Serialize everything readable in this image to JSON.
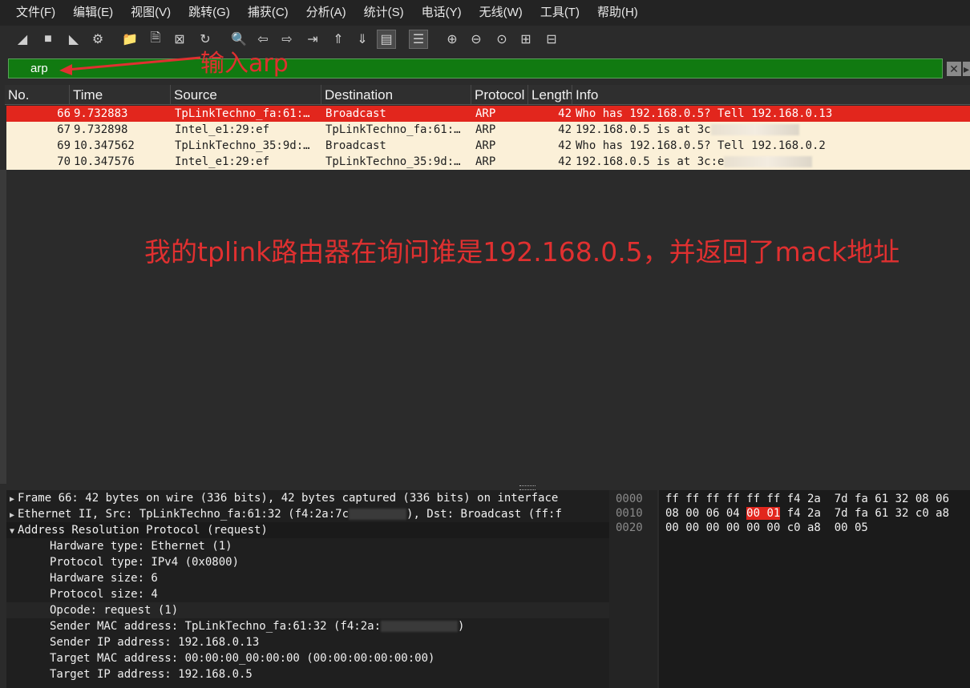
{
  "menu": [
    "文件(F)",
    "编辑(E)",
    "视图(V)",
    "跳转(G)",
    "捕获(C)",
    "分析(A)",
    "统计(S)",
    "电话(Y)",
    "无线(W)",
    "工具(T)",
    "帮助(H)"
  ],
  "toolbar_icons": [
    "shark-fin-start-icon",
    "stop-icon",
    "restart-icon",
    "options-gear-icon",
    "open-folder-icon",
    "file-icon",
    "close-file-icon",
    "reload-icon",
    "find-icon",
    "back-arrow-icon",
    "forward-arrow-icon",
    "goto-packet-icon",
    "first-packet-icon",
    "last-packet-icon",
    "autoscroll-icon",
    "colorize-icon",
    "zoom-in-icon",
    "zoom-out-icon",
    "zoom-normal-icon",
    "resize-columns-icon",
    "layout-icon"
  ],
  "filter": {
    "value": "arp"
  },
  "annotations": {
    "filter_hint": "输入arp",
    "main_note": "我的tplink路由器在询问谁是192.168.0.5，并返回了mack地址"
  },
  "columns": [
    "No.",
    "Time",
    "Source",
    "Destination",
    "Protocol",
    "Length",
    "Info"
  ],
  "packets": [
    {
      "no": "66",
      "time": "9.732883",
      "source": "TpLinkTechno_fa:61:…",
      "destination": "Broadcast",
      "protocol": "ARP",
      "length": "42",
      "info": "Who has 192.168.0.5? Tell 192.168.0.13"
    },
    {
      "no": "67",
      "time": "9.732898",
      "source": "Intel_e1:29:ef",
      "destination": "TpLinkTechno_fa:61:…",
      "protocol": "ARP",
      "length": "42",
      "info": "192.168.0.5 is at 3c"
    },
    {
      "no": "69",
      "time": "10.347562",
      "source": "TpLinkTechno_35:9d:…",
      "destination": "Broadcast",
      "protocol": "ARP",
      "length": "42",
      "info": "Who has 192.168.0.5? Tell 192.168.0.2"
    },
    {
      "no": "70",
      "time": "10.347576",
      "source": "Intel_e1:29:ef",
      "destination": "TpLinkTechno_35:9d:…",
      "protocol": "ARP",
      "length": "42",
      "info": "192.168.0.5 is at 3c:e"
    }
  ],
  "details": {
    "frame": "Frame 66: 42 bytes on wire (336 bits), 42 bytes captured (336 bits) on interface",
    "ethernet_a": "Ethernet II, Src: TpLinkTechno_fa:61:32 (f4:2a:7c",
    "ethernet_b": "), Dst: Broadcast (ff:f",
    "arp": "Address Resolution Protocol (request)",
    "fields": [
      "Hardware type: Ethernet (1)",
      "Protocol type: IPv4 (0x0800)",
      "Hardware size: 6",
      "Protocol size: 4",
      "Opcode: request (1)",
      "Sender MAC address: TpLinkTechno_fa:61:32 (f4:2a:",
      "Sender IP address: 192.168.0.13",
      "Target MAC address: 00:00:00_00:00:00 (00:00:00:00:00:00)",
      "Target IP address: 192.168.0.5"
    ],
    "sender_mac_close": ")"
  },
  "offsets": [
    "0000",
    "0010",
    "0020"
  ],
  "hex": {
    "line0": "ff ff ff ff ff ff f4 2a  7d fa 61 32 08 06",
    "line1_a": "08 00 06 04 ",
    "line1_hl": "00 01",
    "line1_b": " f4 2a  7d fa 61 32 c0 a8",
    "line2": "00 00 00 00 00 00 c0 a8  00 05"
  }
}
